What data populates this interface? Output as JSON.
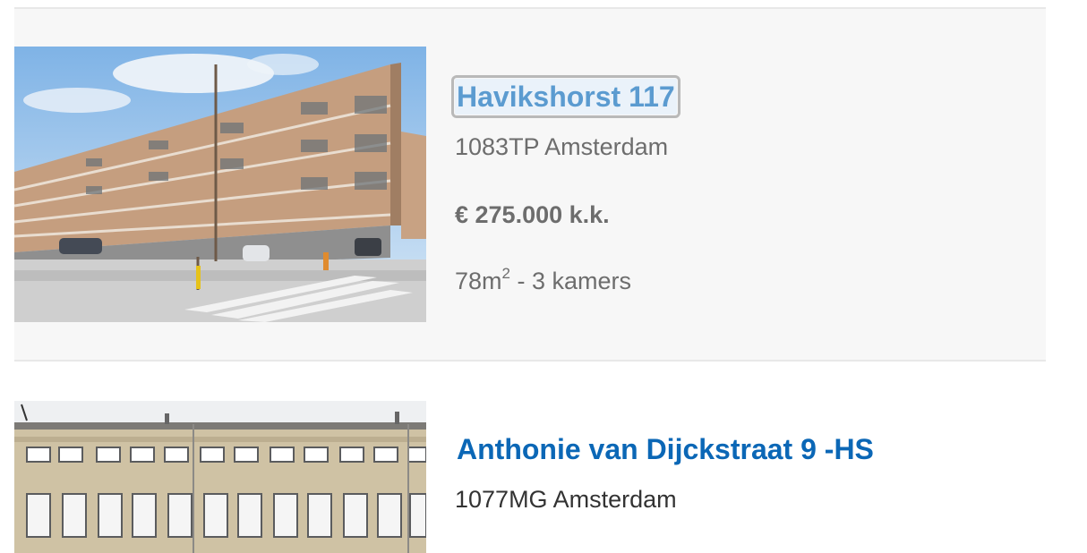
{
  "listings": [
    {
      "title": "Havikshorst 117",
      "city": "1083TP Amsterdam",
      "price": "€ 275.000 k.k.",
      "area_prefix": "78m",
      "area_sup": "2",
      "rooms": " - 3 kamers"
    },
    {
      "title": "Anthonie van Dijckstraat 9 -HS",
      "city": "1077MG Amsterdam"
    }
  ],
  "colors": {
    "link": "#0b67b6",
    "link_focused": "#5b9bd0",
    "muted_text": "#6d6d6d",
    "card_background": "#f7f7f7"
  }
}
